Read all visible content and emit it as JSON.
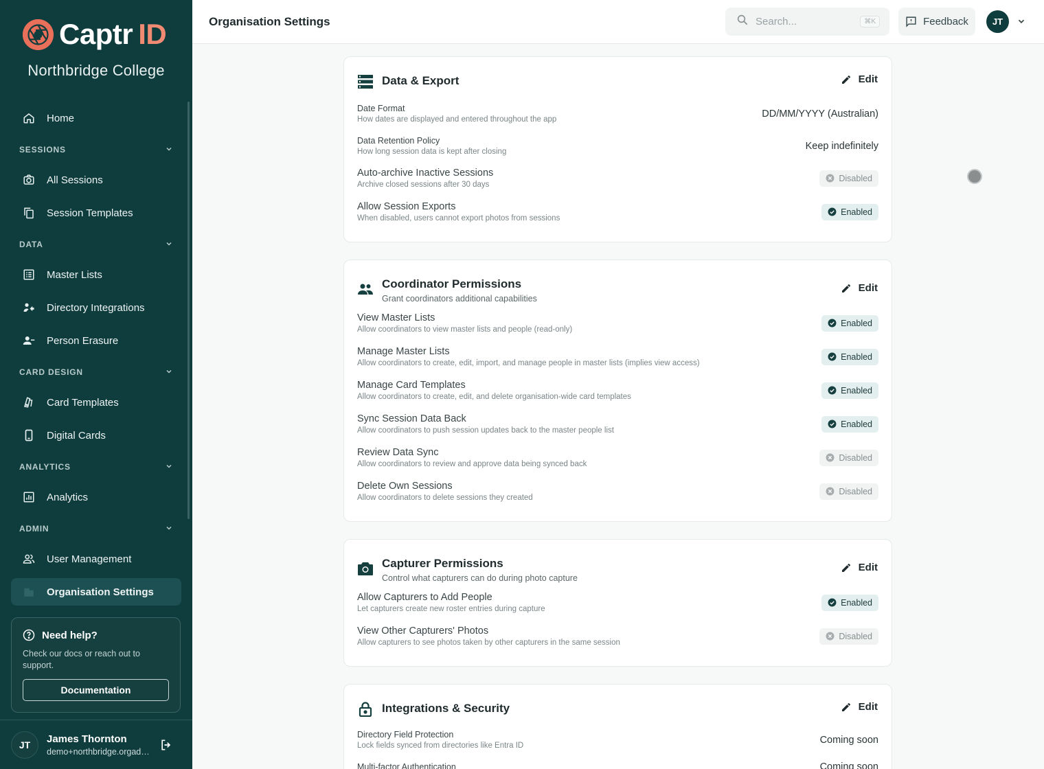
{
  "brand": {
    "name_part1": "Captr",
    "name_part2": "ID",
    "org_name": "Northbridge College",
    "accent": "#e8705a",
    "sidebar_bg": "#0f3c3d"
  },
  "sidebar": {
    "home": "Home",
    "sections": {
      "sessions": "SESSIONS",
      "data": "DATA",
      "card_design": "CARD DESIGN",
      "analytics": "ANALYTICS",
      "admin": "ADMIN"
    },
    "items": {
      "all_sessions": "All Sessions",
      "session_templates": "Session Templates",
      "master_lists": "Master Lists",
      "directory_integrations": "Directory Integrations",
      "person_erasure": "Person Erasure",
      "card_templates": "Card Templates",
      "digital_cards": "Digital Cards",
      "analytics": "Analytics",
      "user_management": "User Management",
      "organisation_settings": "Organisation Settings"
    },
    "help": {
      "title": "Need help?",
      "text": "Check our docs or reach out to support.",
      "button": "Documentation"
    },
    "user": {
      "initials": "JT",
      "name": "James Thornton",
      "email": "demo+northbridge.orgadmin@captrid.com"
    }
  },
  "header": {
    "title": "Organisation Settings",
    "search_placeholder": "Search...",
    "search_shortcut": "⌘K",
    "feedback": "Feedback",
    "avatar_initials": "JT"
  },
  "common": {
    "edit": "Edit",
    "enabled": "Enabled",
    "disabled": "Disabled"
  },
  "cards": {
    "data_export": {
      "title": "Data & Export",
      "rows": [
        {
          "label": "Date Format",
          "desc": "How dates are displayed and entered throughout the app",
          "value": "DD/MM/YYYY (Australian)"
        },
        {
          "label": "Data Retention Policy",
          "desc": "How long session data is kept after closing",
          "value": "Keep indefinitely"
        },
        {
          "label": "Auto-archive Inactive Sessions",
          "desc": "Archive closed sessions after 30 days",
          "status": "Disabled"
        },
        {
          "label": "Allow Session Exports",
          "desc": "When disabled, users cannot export photos from sessions",
          "status": "Enabled"
        }
      ]
    },
    "coordinator": {
      "title": "Coordinator Permissions",
      "subtitle": "Grant coordinators additional capabilities",
      "rows": [
        {
          "label": "View Master Lists",
          "desc": "Allow coordinators to view master lists and people (read-only)",
          "status": "Enabled"
        },
        {
          "label": "Manage Master Lists",
          "desc": "Allow coordinators to create, edit, import, and manage people in master lists (implies view access)",
          "status": "Enabled"
        },
        {
          "label": "Manage Card Templates",
          "desc": "Allow coordinators to create, edit, and delete organisation-wide card templates",
          "status": "Enabled"
        },
        {
          "label": "Sync Session Data Back",
          "desc": "Allow coordinators to push session updates back to the master people list",
          "status": "Enabled"
        },
        {
          "label": "Review Data Sync",
          "desc": "Allow coordinators to review and approve data being synced back",
          "status": "Disabled"
        },
        {
          "label": "Delete Own Sessions",
          "desc": "Allow coordinators to delete sessions they created",
          "status": "Disabled"
        }
      ]
    },
    "capturer": {
      "title": "Capturer Permissions",
      "subtitle": "Control what capturers can do during photo capture",
      "rows": [
        {
          "label": "Allow Capturers to Add People",
          "desc": "Let capturers create new roster entries during capture",
          "status": "Enabled"
        },
        {
          "label": "View Other Capturers' Photos",
          "desc": "Allow capturers to see photos taken by other capturers in the same session",
          "status": "Disabled"
        }
      ]
    },
    "integrations": {
      "title": "Integrations & Security",
      "rows": [
        {
          "label": "Directory Field Protection",
          "desc": "Lock fields synced from directories like Entra ID",
          "value": "Coming soon"
        },
        {
          "label": "Multi-factor Authentication",
          "value": "Coming soon"
        }
      ]
    }
  }
}
